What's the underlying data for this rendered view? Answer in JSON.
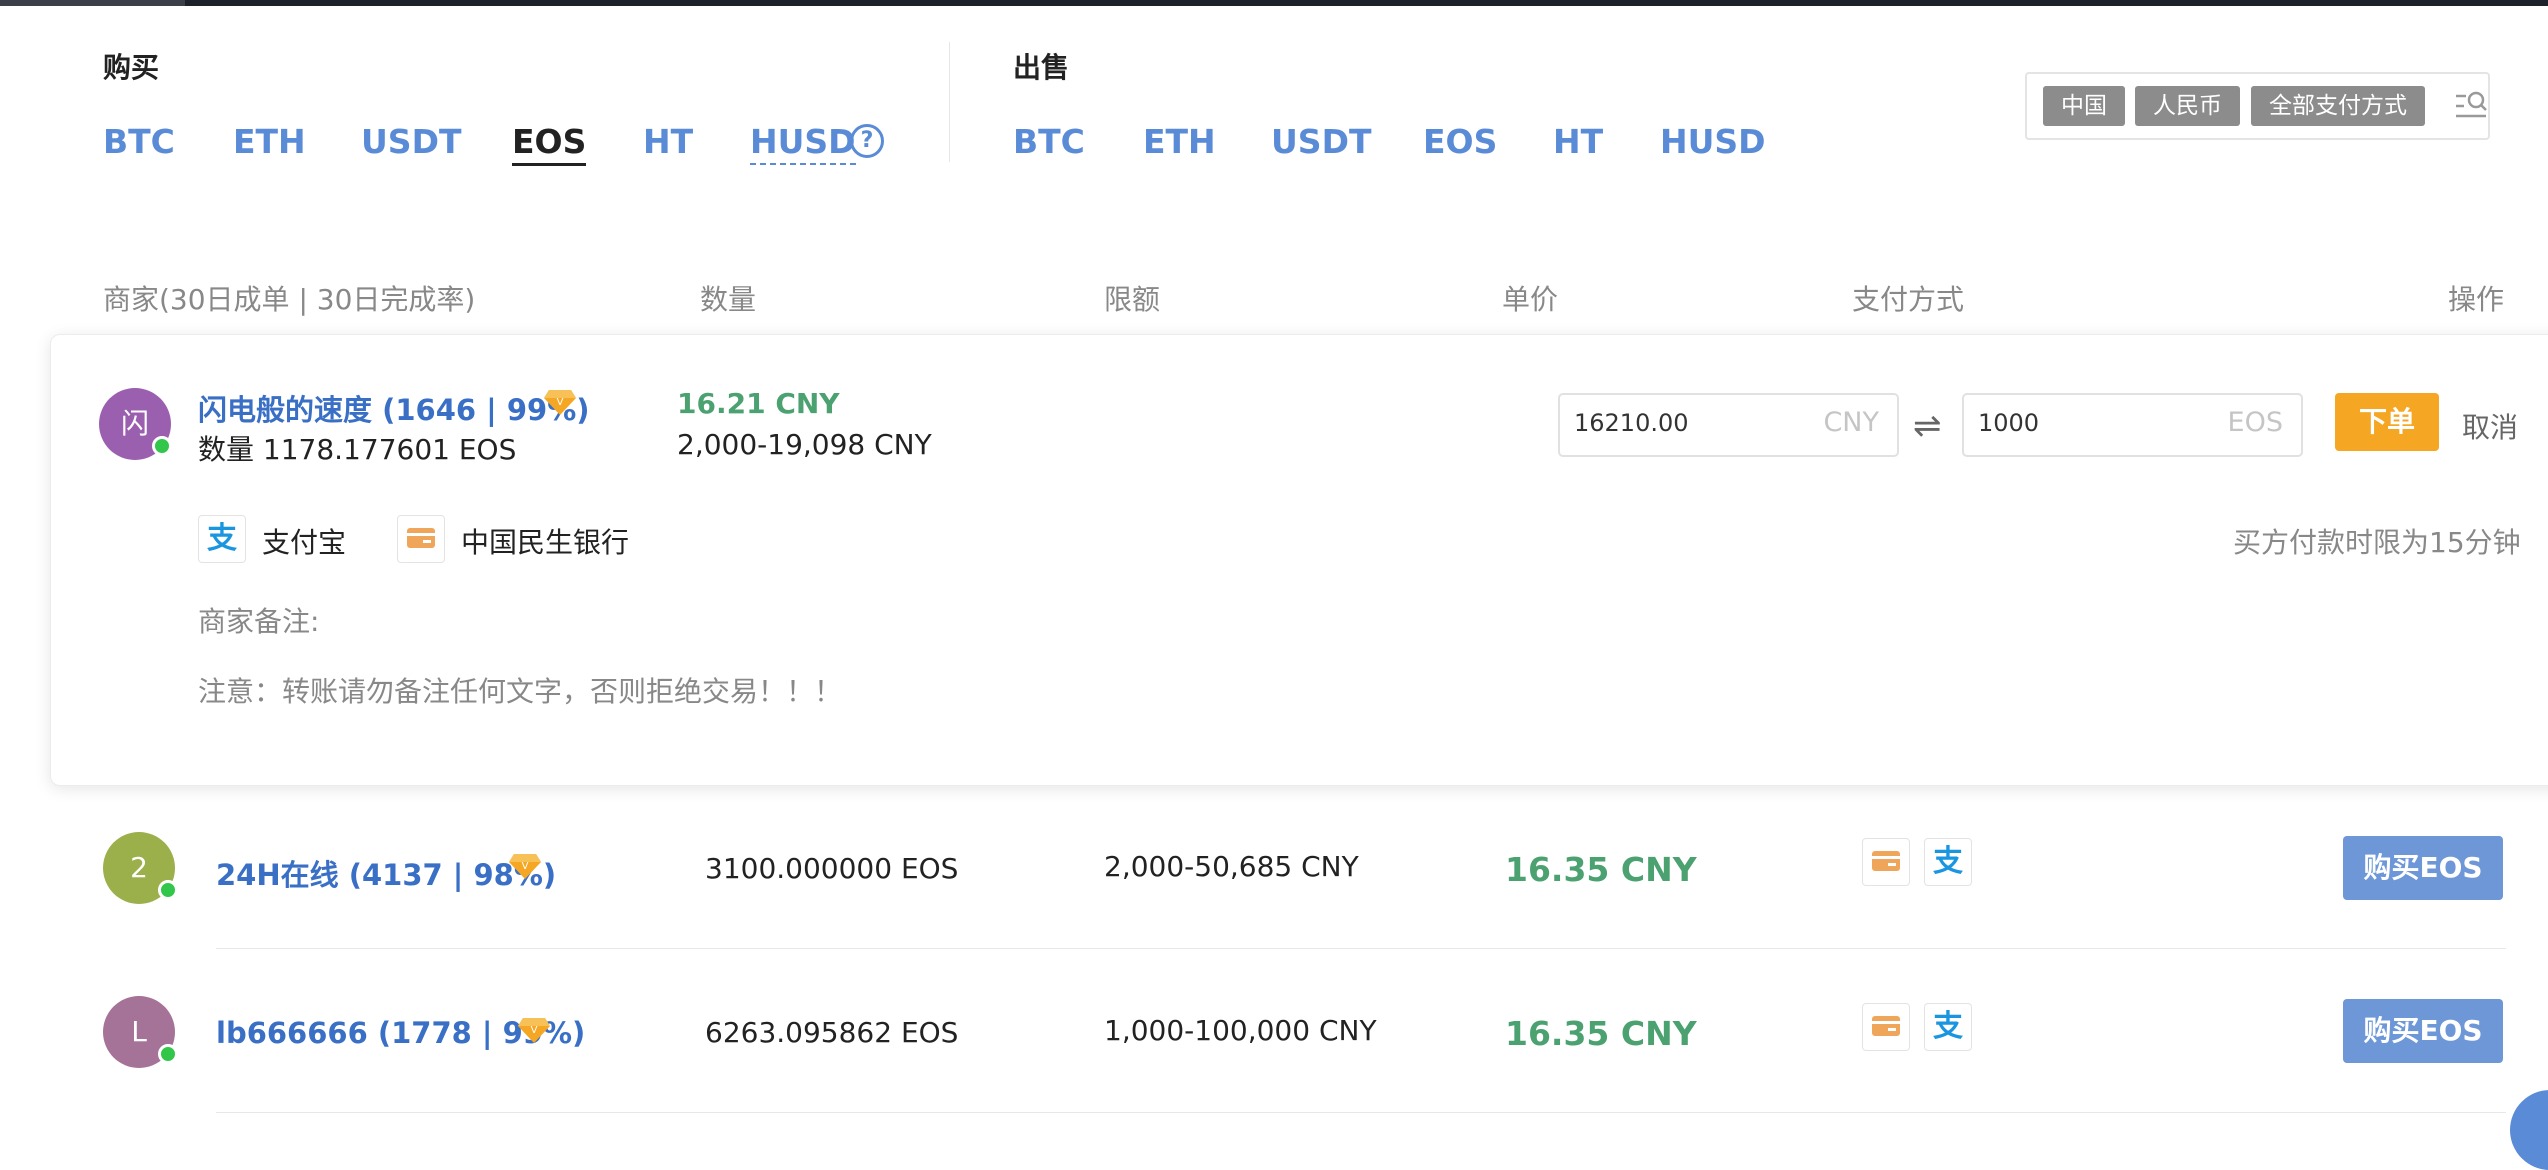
{
  "header": {
    "buy_label": "购买",
    "sell_label": "出售",
    "buy_coins": [
      "BTC",
      "ETH",
      "USDT",
      "EOS",
      "HT",
      "HUSD"
    ],
    "active_buy_coin": "EOS",
    "sell_coins": [
      "BTC",
      "ETH",
      "USDT",
      "EOS",
      "HT",
      "HUSD"
    ],
    "help_icon_glyph": "?"
  },
  "filter": {
    "region": "中国",
    "currency": "人民币",
    "payment": "全部支付方式",
    "icon": "filter-search-icon"
  },
  "columns": {
    "merchant": "商家(30日成单 | 30日完成率)",
    "amount": "数量",
    "limit": "限额",
    "price": "单价",
    "payment": "支付方式",
    "action": "操作"
  },
  "expanded": {
    "avatar_char": "闪",
    "merchant_name": "闪电般的速度 (1646 | 99%)",
    "amount_text": "数量 1178.177601 EOS",
    "price": "16.21 CNY",
    "limit": "2,000-19,098 CNY",
    "cny_value": "16210.00",
    "cny_unit": "CNY",
    "swap_glyph": "⇌",
    "eos_value": "1000",
    "eos_unit": "EOS",
    "order_button": "下单",
    "cancel_button": "取消",
    "payment_methods": [
      {
        "name": "支付宝",
        "icon": "alipay-icon"
      },
      {
        "name": "中国民生银行",
        "icon": "bank-card-icon"
      }
    ],
    "time_limit": "买方付款时限为15分钟",
    "remark_label": "商家备注:",
    "remark_text": "注意：转账请勿备注任何文字，否则拒绝交易！！！"
  },
  "rows": [
    {
      "avatar_char": "2",
      "avatar_color": "#9bb04a",
      "merchant": "24H在线 (4137 | 98%)",
      "amount": "3100.000000 EOS",
      "limit": "2,000-50,685 CNY",
      "price": "16.35 CNY",
      "button": "购买EOS"
    },
    {
      "avatar_char": "L",
      "avatar_color": "#a57298",
      "merchant": "lb666666 (1778 | 99%)",
      "amount": "6263.095862 EOS",
      "limit": "1,000-100,000 CNY",
      "price": "16.35 CNY",
      "button": "购买EOS"
    }
  ],
  "colors": {
    "link_blue": "#5a8bd6",
    "price_green": "#4ba270",
    "order_orange": "#f5a623",
    "buy_button": "#6e97d8",
    "expanded_avatar": "#9b5fb0"
  }
}
